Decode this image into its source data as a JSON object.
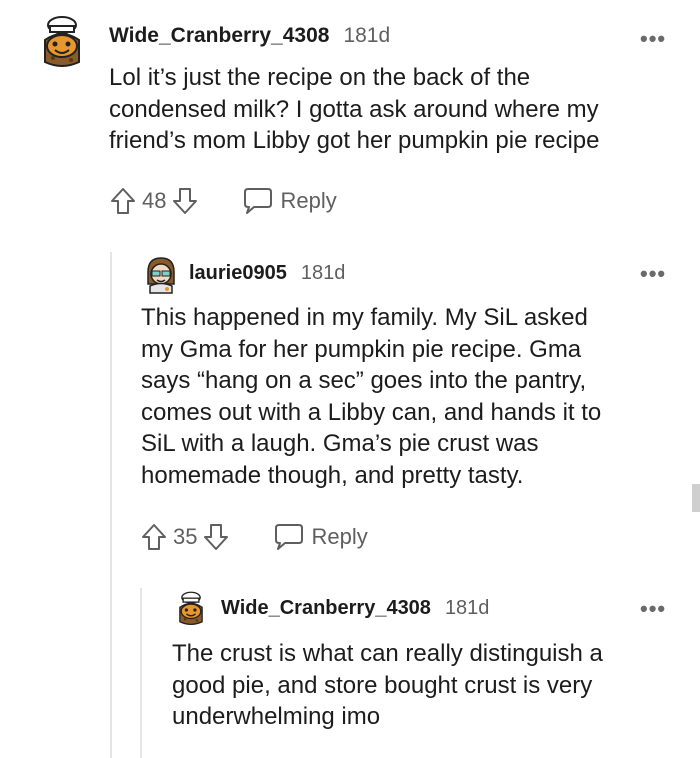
{
  "comments": [
    {
      "username": "Wide_Cranberry_4308",
      "age": "181d",
      "lines": [
        "Lol it’s just the recipe on the back of the",
        "condensed milk? I gotta ask around where my",
        "friend’s mom Libby got her pumpkin pie recipe"
      ],
      "votes": "48",
      "reply_label": "Reply",
      "more_label": "•••"
    },
    {
      "username": "laurie0905",
      "age": "181d",
      "lines": [
        "This happened in my family. My SiL asked",
        "my Gma for her pumpkin pie recipe. Gma",
        "says “hang on a sec” goes into the pantry,",
        "comes out with a Libby can, and hands it to",
        "SiL with a laugh. Gma’s pie crust was",
        "homemade though, and pretty tasty."
      ],
      "votes": "35",
      "reply_label": "Reply",
      "more_label": "•••"
    },
    {
      "username": "Wide_Cranberry_4308",
      "age": "181d",
      "lines": [
        "The crust is what can really distinguish a",
        "good pie, and store bought crust is very",
        "underwhelming imo"
      ],
      "more_label": "•••"
    }
  ],
  "icons": {
    "avatar_1": "cookie-chef-avatar-icon",
    "avatar_2": "girl-avatar-icon",
    "upvote": "upvote-arrow-icon",
    "downvote": "downvote-arrow-icon",
    "reply": "speech-bubble-icon",
    "more": "more-options-icon"
  },
  "colors": {
    "text": "#1c1c1c",
    "meta": "#5f5f5f",
    "thread_line": "#e5e5e5",
    "avatar_orange": "#e8962e",
    "avatar_brown": "#8a5a2b"
  }
}
